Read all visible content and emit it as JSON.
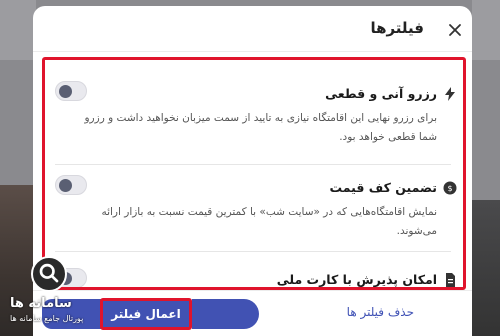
{
  "modal": {
    "title": "فیلترها"
  },
  "filters": [
    {
      "title": "رزرو آنی و قطعی",
      "description": "برای رزرو نهایی این اقامتگاه نیازی به تایید از سمت میزبان نخواهید داشت و رزرو شما قطعی خواهد بود.",
      "icon": "lightning-icon",
      "enabled": false
    },
    {
      "title": "تضمین کف قیمت",
      "description": "نمایش اقامتگاه‌هایی که در «سایت شب» با کمترین قیمت نسبت به بازار ارائه می‌شوند.",
      "icon": "price-guarantee-icon",
      "enabled": false
    },
    {
      "title": "امکان پذیرش با کارت ملی",
      "icon": "id-card-icon",
      "enabled": false
    }
  ],
  "footer": {
    "apply_label": "اعمال فیلتر",
    "clear_label": "حذف فیلتر ها"
  },
  "watermark": {
    "name": "سامانه ها",
    "subtitle": "پورتال جامع سامانه ها"
  },
  "colors": {
    "accent": "#4152b3",
    "highlight": "#e0142c",
    "toggle_knob": "#5a5f73"
  }
}
